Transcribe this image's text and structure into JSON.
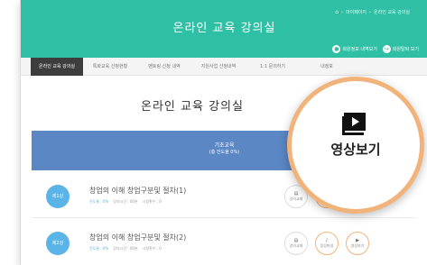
{
  "header": {
    "title": "온라인 교육 강의실",
    "breadcrumb": [
      "마이페이지",
      "온라인 교육 강의실"
    ],
    "links": [
      {
        "label": "회원정보 내역보기",
        "icon": "user-icon"
      },
      {
        "label": "회원탈퇴 보기",
        "icon": "logout-icon"
      }
    ],
    "color": "#2fbfa4"
  },
  "tabs": [
    {
      "label": "온라인 교육 강의실",
      "active": true
    },
    {
      "label": "특화교육 신청현황"
    },
    {
      "label": "멘토링 신청 내역"
    },
    {
      "label": "지원사업 신청내역"
    },
    {
      "label": "1:1 문의하기"
    },
    {
      "label": "내정보"
    }
  ],
  "page_title": "온라인 교육 강의실",
  "course": {
    "title": "기초교육",
    "progress_text": "(총 진도율 0%)",
    "progress": 0,
    "color": "#5b87c4"
  },
  "lectures": [
    {
      "num": "제1강",
      "title": "창업의 이해 창업구분및 절차(1)",
      "rate": "진도율 : 0%",
      "time": "강의시간 : 00분",
      "views": "시청횟수 : 0",
      "buttons": [
        {
          "label": "강의교재",
          "icon": "book-icon"
        },
        {
          "label": "음성파일",
          "icon": "audio-icon"
        },
        {
          "label": "영상보기",
          "icon": "play-icon"
        }
      ]
    },
    {
      "num": "제2강",
      "title": "창업의 이해 창업구분및 절차(2)",
      "rate": "진도율 : 0%",
      "time": "강의시간 : 00분",
      "views": "시청횟수 : 0",
      "buttons": [
        {
          "label": "강의교재",
          "icon": "book-icon"
        },
        {
          "label": "음성파일",
          "icon": "audio-icon"
        },
        {
          "label": "영상보기",
          "icon": "play-icon"
        }
      ]
    }
  ],
  "zoom": {
    "label": "영상보기",
    "icon": "play-video-icon",
    "accent": "#f2b37a"
  }
}
